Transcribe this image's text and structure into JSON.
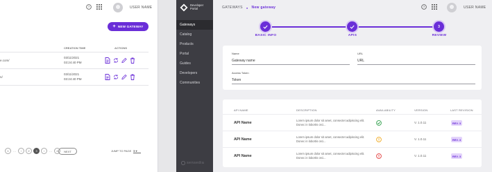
{
  "left_screen": {
    "user_name": "USER NAME",
    "new_gateway_label": "NEW GATEWAY",
    "columns": {
      "creation_time": "CREATION TIME",
      "actions": "ACTIONS"
    },
    "rows": [
      {
        "url_fragment": "e.com/",
        "date": "03/11/2021",
        "time": "03:24:40 PM"
      },
      {
        "url_fragment": "n/",
        "date": "03/11/2021",
        "time": "03:24:40 PM"
      }
    ],
    "pagination": {
      "pages": [
        "1",
        "2",
        "3",
        "4"
      ],
      "current": "3",
      "next_label": "NEXT",
      "jump_label": "JUMP TO PAGE",
      "jump_value": "5"
    }
  },
  "sidebar": {
    "logo_line1": "Developer",
    "logo_line2": "Portal",
    "items": [
      {
        "label": "Gateways",
        "active": true
      },
      {
        "label": "Catalog",
        "active": false
      },
      {
        "label": "Products",
        "active": false
      },
      {
        "label": "Portal",
        "active": false
      },
      {
        "label": "Guides",
        "active": false
      },
      {
        "label": "Developers",
        "active": false
      },
      {
        "label": "Communities",
        "active": false
      }
    ],
    "brand": "sensedia"
  },
  "header": {
    "breadcrumb_root": "GATEWAYS",
    "breadcrumb_current": "New gateway",
    "user_name": "USER NAME"
  },
  "stepper": {
    "steps": [
      {
        "label": "BASIC INFO",
        "state": "done"
      },
      {
        "label": "APIS",
        "state": "done"
      },
      {
        "label": "REVIEW",
        "state": "current",
        "number": "3"
      }
    ]
  },
  "form": {
    "name_label": "Name",
    "name_value": "Gateway name",
    "url_label": "URL",
    "url_value": "URL",
    "token_label": "Access Token",
    "token_value": "Token"
  },
  "api_table": {
    "columns": {
      "name": "API NAME",
      "description": "DESCRIPTION",
      "availability": "AVAILABILITY",
      "version": "VERSION",
      "last_revision": "LAST REVISION"
    },
    "rows": [
      {
        "name": "API Name",
        "description": "Lorem ipsum dolor sit amet, consectet adipiscing elit. Donec in lobortis orci...",
        "availability": "available",
        "version": "V. 1.0.11",
        "revision": "REV. 3"
      },
      {
        "name": "API Name",
        "description": "Lorem ipsum dolor sit amet, consectet adipiscing elit. Donec in lobortis orci...",
        "availability": "warning",
        "version": "V. 1.0.11",
        "revision": "REV. 3"
      },
      {
        "name": "API Name",
        "description": "Lorem ipsum dolor sit amet, consectet adipiscing elit. Donec in lobortis orci...",
        "availability": "error",
        "version": "V. 1.0.11",
        "revision": "REV. 3"
      }
    ]
  },
  "colors": {
    "accent": "#6a2ed8",
    "sidebar_bg": "#3d3d43",
    "ok": "#2e9e4a",
    "warn": "#f0a81c",
    "error": "#e23b3b"
  }
}
